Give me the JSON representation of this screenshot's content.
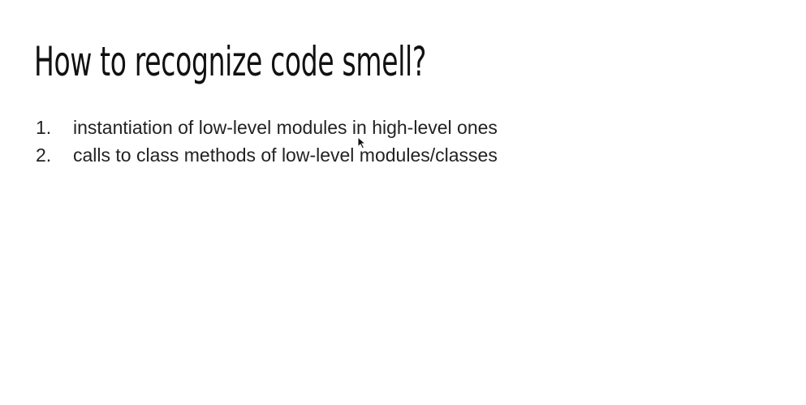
{
  "slide": {
    "title": "How to recognize code smell?",
    "items": [
      {
        "number": "1.",
        "text": "instantiation of low-level modules in high-level ones"
      },
      {
        "number": "2.",
        "text": "calls to class methods of low-level modules/classes"
      }
    ]
  },
  "cursor": {
    "icon": "mouse-pointer-icon"
  }
}
